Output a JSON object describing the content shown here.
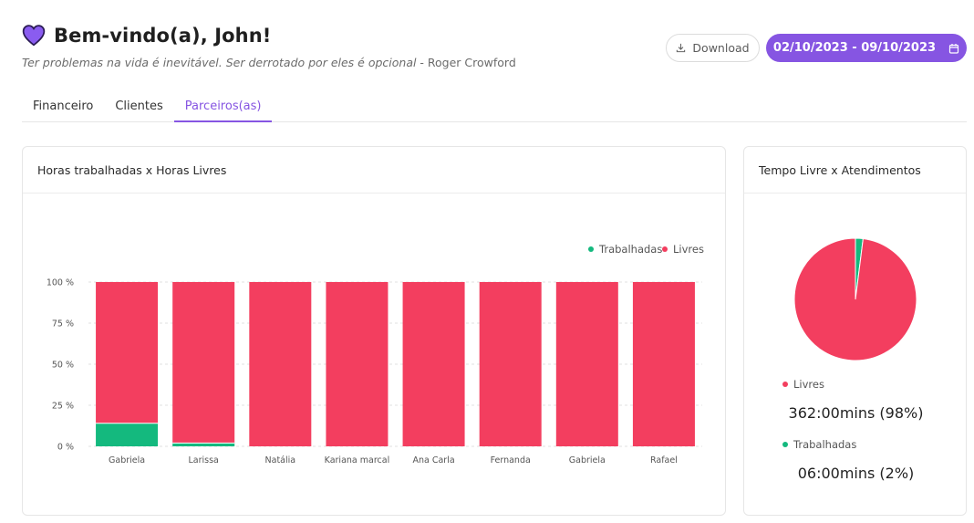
{
  "header": {
    "title": "Bem-vindo(a), John!",
    "quote": "Ter problemas na vida é inevitável. Ser derrotado por eles é opcional",
    "author": " - Roger Crowford",
    "icon": "heart-icon"
  },
  "toolbar": {
    "download_label": "Download",
    "date_range": "02/10/2023 - 09/10/2023"
  },
  "tabs": [
    {
      "label": "Financeiro",
      "active": false
    },
    {
      "label": "Clientes",
      "active": false
    },
    {
      "label": "Parceiros(as)",
      "active": true
    }
  ],
  "colors": {
    "accent": "#8655e2",
    "trabalhadas": "#14b97e",
    "livres": "#f33e5f"
  },
  "bar_card": {
    "title": "Horas trabalhadas x Horas Livres"
  },
  "pie_card": {
    "title": "Tempo Livre x Atendimentos",
    "livres_label": "Livres",
    "livres_value": "362:00mins (98%)",
    "trabalhadas_label": "Trabalhadas",
    "trabalhadas_value": "06:00mins (2%)"
  },
  "chart_data": [
    {
      "type": "bar",
      "stacked": true,
      "title": "Horas trabalhadas x Horas Livres",
      "categories": [
        "Gabriela",
        "Larissa",
        "Natália",
        "Kariana marcal",
        "Ana Carla",
        "Fernanda",
        "Gabriela",
        "Rafael"
      ],
      "series": [
        {
          "name": "Trabalhadas",
          "color": "#14b97e",
          "values": [
            14,
            2,
            0,
            0,
            0,
            0,
            0,
            0
          ]
        },
        {
          "name": "Livres",
          "color": "#f33e5f",
          "values": [
            86,
            98,
            100,
            100,
            100,
            100,
            100,
            100
          ]
        }
      ],
      "y_ticks": [
        "0 %",
        "25 %",
        "50 %",
        "75 %",
        "100 %"
      ],
      "ylim": [
        0,
        100
      ],
      "grid": true,
      "legend_position": "top-right"
    },
    {
      "type": "pie",
      "title": "Tempo Livre x Atendimentos",
      "labels": [
        "Livres",
        "Trabalhadas"
      ],
      "values": [
        98,
        2
      ],
      "colors": [
        "#f33e5f",
        "#14b97e"
      ]
    }
  ]
}
